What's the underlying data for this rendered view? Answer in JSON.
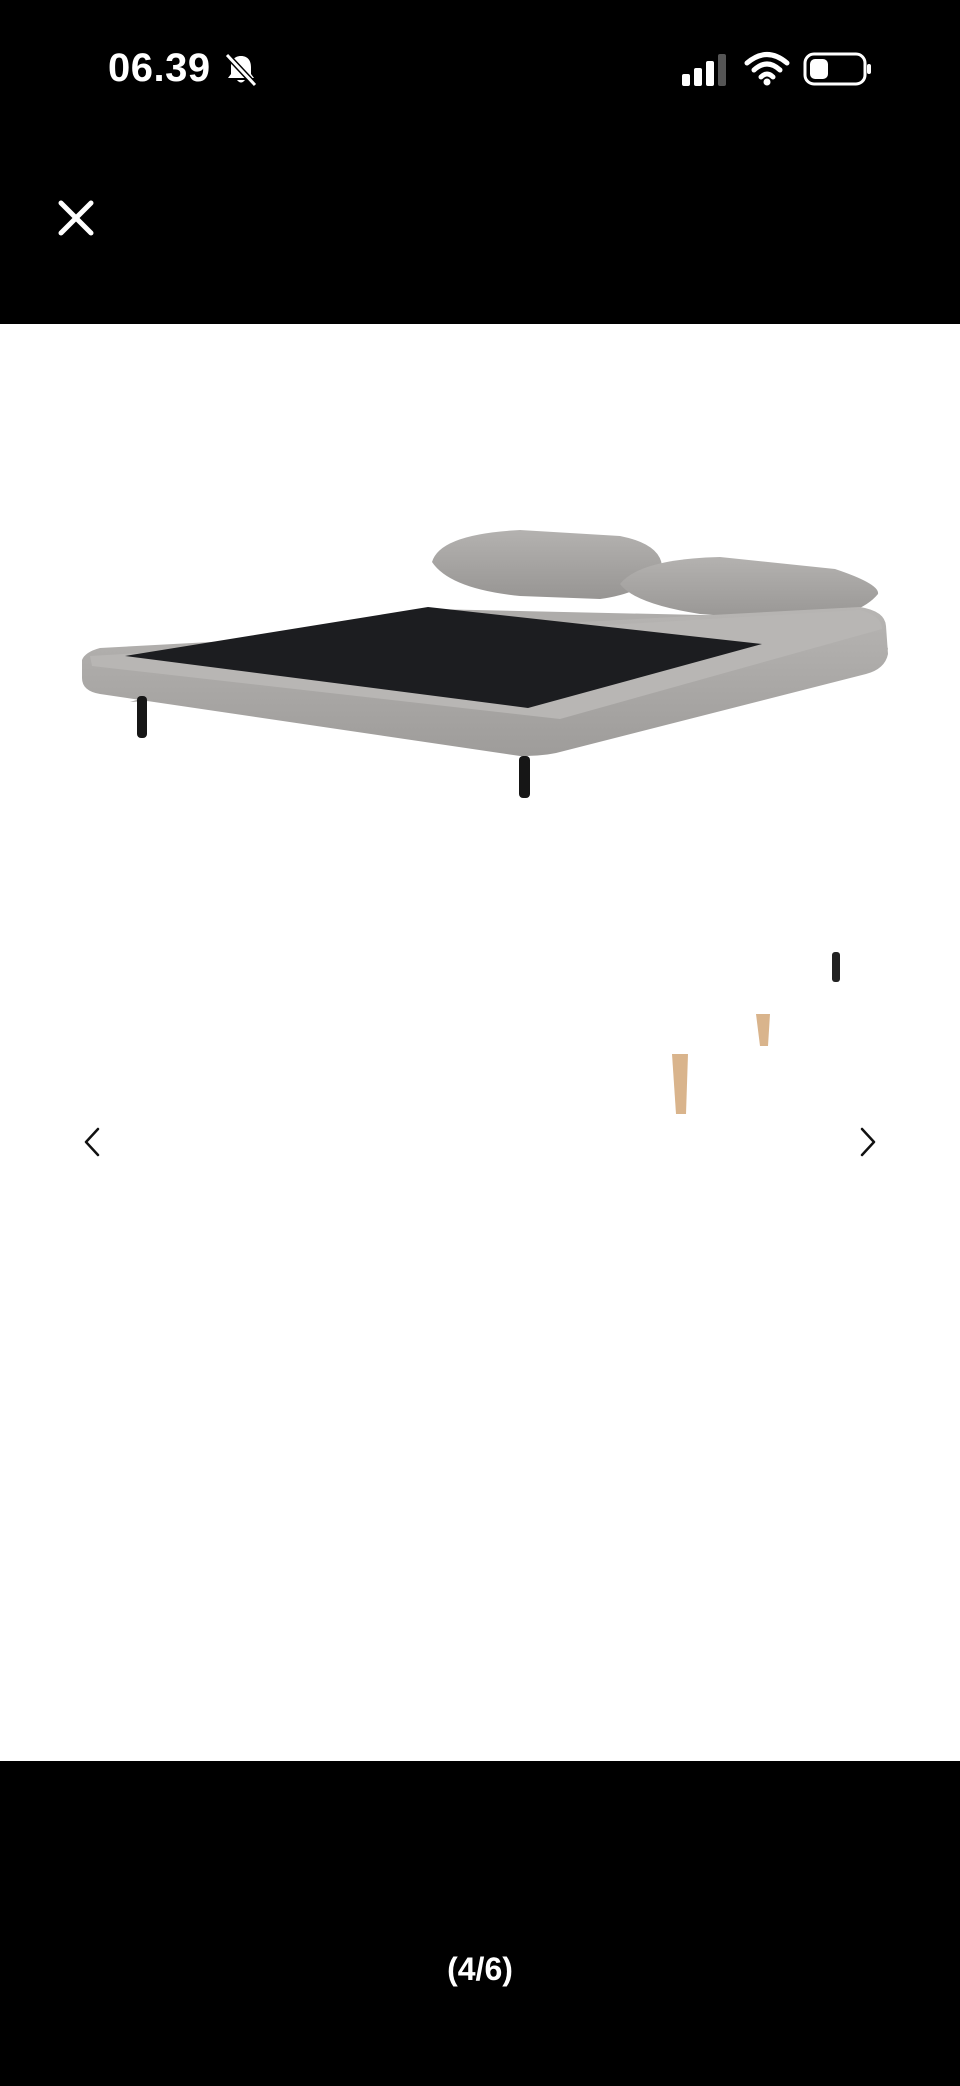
{
  "status_bar": {
    "time": "06.39",
    "icons": [
      "bell-slash-icon",
      "cellular-signal-icon",
      "wifi-icon",
      "battery-icon"
    ]
  },
  "viewer": {
    "close_icon": "close-icon",
    "image_description_icon": "sofa-bed-image",
    "prev_icon": "chevron-left-icon",
    "next_icon": "chevron-right-icon",
    "page_counter": "(4/6)",
    "current_image": 4,
    "total_images": 6
  },
  "colors": {
    "background": "#000000",
    "image_background": "#ffffff",
    "fabric": "#a9a7a5",
    "panel": "#1c1d20"
  }
}
